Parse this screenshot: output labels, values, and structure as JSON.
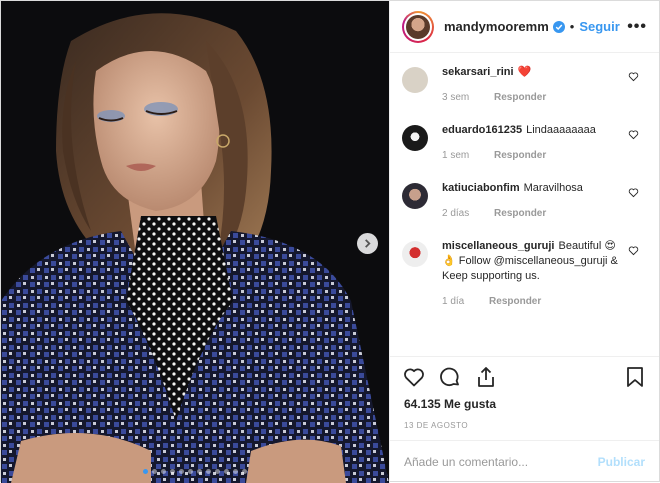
{
  "header": {
    "username": "mandymooremm",
    "separator": "•",
    "follow_label": "Seguir",
    "more_label": "•••"
  },
  "comments": [
    {
      "user": "sekarsari_rini",
      "text": "❤️",
      "time": "3 sem",
      "reply": "Responder"
    },
    {
      "user": "eduardo161235",
      "text": "Lindaaaaaaaa",
      "time": "1 sem",
      "reply": "Responder"
    },
    {
      "user": "katiuciabonfim",
      "text": "Maravilhosa",
      "time": "2 días",
      "reply": "Responder"
    },
    {
      "user": "miscellaneous_guruji",
      "text": "Beautiful 😍👌 Follow @miscellaneous_guruji & Keep supporting us.",
      "time": "1 día",
      "reply": "Responder"
    }
  ],
  "stats": {
    "likes": "64.135 Me gusta",
    "date": "13 DE AGOSTO"
  },
  "composer": {
    "placeholder": "Añade un comentario...",
    "publish_label": "Publicar"
  },
  "carousel": {
    "slide_count": 12,
    "active_slide": 1
  },
  "colors": {
    "accent": "#3897f0",
    "publish_disabled": "#b2dffc",
    "heart": "#ed4956"
  }
}
